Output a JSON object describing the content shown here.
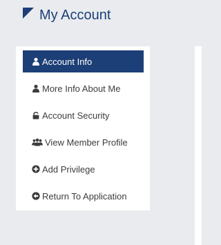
{
  "header": {
    "title": "My Account",
    "icon": "triangle-corner-icon"
  },
  "menu": {
    "items": [
      {
        "label": "Account Info",
        "icon": "user-icon",
        "active": true
      },
      {
        "label": "More Info About Me",
        "icon": "user-icon",
        "active": false
      },
      {
        "label": "Account Security",
        "icon": "unlock-icon",
        "active": false
      },
      {
        "label": "View Member Profile",
        "icon": "users-icon",
        "active": false
      },
      {
        "label": "Add Privilege",
        "icon": "plus-circle-icon",
        "active": false
      },
      {
        "label": "Return To Application",
        "icon": "arrow-circle-left-icon",
        "active": false
      }
    ]
  },
  "colors": {
    "accent": "#1d3f77",
    "background": "#e9ebef",
    "panel": "#ffffff",
    "text": "#3c3c3c"
  }
}
